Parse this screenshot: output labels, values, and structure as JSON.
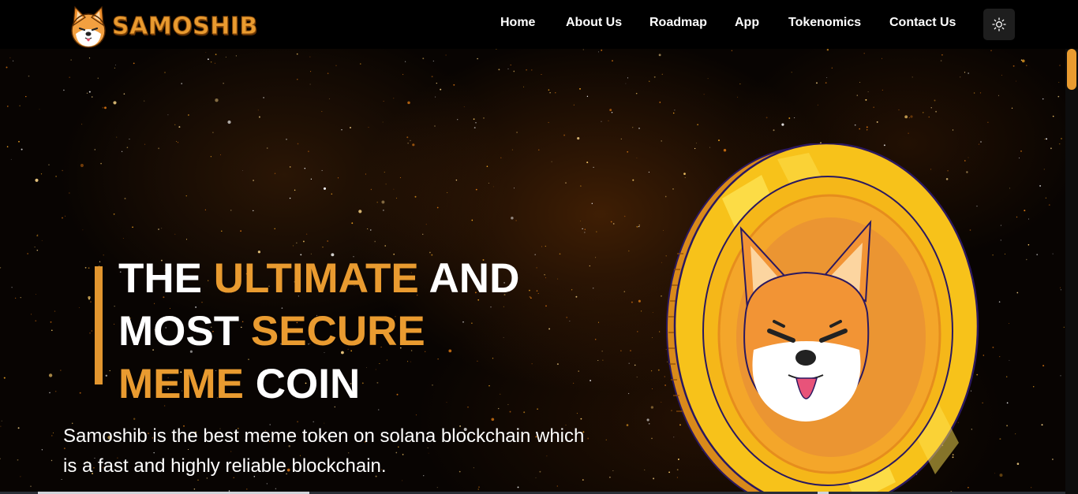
{
  "brand": {
    "name": "SAMOSHIB",
    "logo_icon": "shiba-dog-logo"
  },
  "nav": {
    "items": [
      {
        "label": "Home"
      },
      {
        "label": "About Us"
      },
      {
        "label": "Roadmap"
      },
      {
        "label": "App"
      },
      {
        "label": "Tokenomics"
      },
      {
        "label": "Contact Us"
      }
    ],
    "theme_toggle_icon": "sun-icon"
  },
  "hero": {
    "heading": {
      "w1": "THE",
      "w2": "ULTIMATE",
      "w3": "AND",
      "w4": "MOST",
      "w5": "SECURE",
      "w6": "MEME",
      "w7": "COIN"
    },
    "description": "Samoshib is the best meme token on solana blockchain which is a fast and highly reliable blockchain.",
    "coin_icon": "shiba-coin-icon"
  },
  "colors": {
    "accent": "#e99b30",
    "background": "#000000",
    "text": "#ffffff",
    "coin_gold": "#f7c21a",
    "coin_orange": "#eb9532"
  }
}
